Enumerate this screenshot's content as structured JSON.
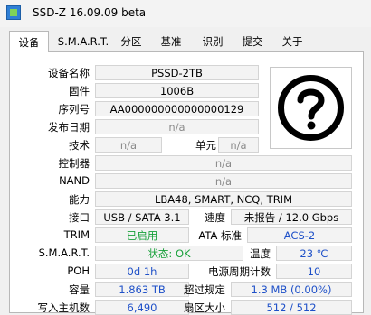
{
  "window": {
    "title": "SSD-Z 16.09.09 beta"
  },
  "tabs": [
    {
      "label": "设备"
    },
    {
      "label": "S.M.A.R.T."
    },
    {
      "label": "分区"
    },
    {
      "label": "基准"
    },
    {
      "label": "识别"
    },
    {
      "label": "提交"
    },
    {
      "label": "关于"
    }
  ],
  "device": {
    "name_label": "设备名称",
    "name": "PSSD-2TB",
    "firmware_label": "固件",
    "firmware": "1006B",
    "serial_label": "序列号",
    "serial": "AA000000000000000129",
    "release_label": "发布日期",
    "release": "n/a",
    "tech_label": "技术",
    "tech": "n/a",
    "cell_label": "单元",
    "cell": "n/a",
    "controller_label": "控制器",
    "controller": "n/a",
    "nand_label": "NAND",
    "nand": "n/a",
    "capability_label": "能力",
    "capability": "LBA48, SMART, NCQ, TRIM",
    "interface_label": "接口",
    "interface": "USB / SATA 3.1",
    "speed_label": "速度",
    "speed": "未报告 / 12.0 Gbps",
    "trim_label": "TRIM",
    "trim": "已启用",
    "ata_label": "ATA 标准",
    "ata": "ACS-2",
    "smart_label": "S.M.A.R.T.",
    "smart": "状态: OK",
    "temp_label": "温度",
    "temp": "23 ℃",
    "poh_label": "POH",
    "poh": "0d 1h",
    "power_cycles_label": "电源周期计数",
    "power_cycles": "10",
    "capacity_label": "容量",
    "capacity": "1.863 TB",
    "over_prov_label": "超过规定",
    "over_prov": "1.3 MB (0.00%)",
    "host_writes_label": "写入主机数",
    "host_writes": "6,490",
    "sector_label": "扇区大小",
    "sector": "512 / 512"
  },
  "icons": {
    "device_image": "question-mark-icon",
    "app": "ssdz-app-icon"
  },
  "colors": {
    "ok_green": "#18a03a",
    "value_blue": "#1e50c8",
    "value_red": "#d03030"
  }
}
